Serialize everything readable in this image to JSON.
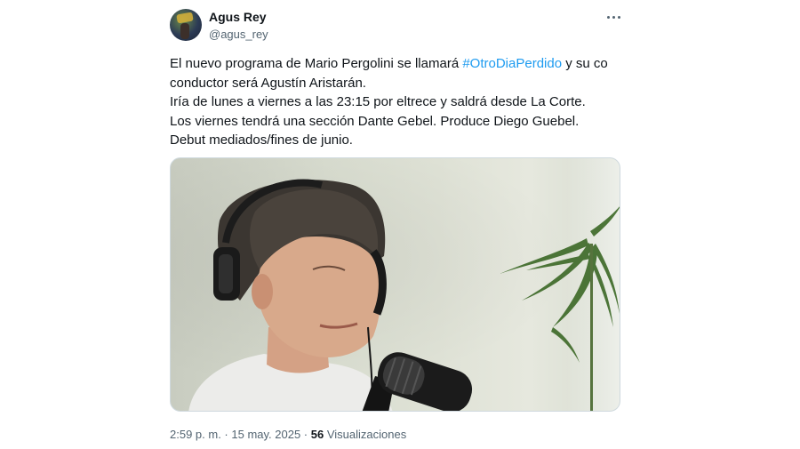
{
  "author": {
    "name": "Agus Rey",
    "handle": "@agus_rey"
  },
  "tweet": {
    "line1_prefix": "El nuevo programa de Mario Pergolini se llamará ",
    "hashtag": "#OtroDiaPerdido",
    "line1_suffix": " y su co",
    "line2": "conductor será Agustín Aristarán.",
    "line3": "Iría de lunes a viernes a las 23:15 por eltrece y saldrá desde La Corte.",
    "line4": "Los viernes tendrá una sección Dante Gebel. Produce Diego Guebel.",
    "line5": "Debut mediados/fines de junio."
  },
  "footer": {
    "time": "2:59 p. m.",
    "separator1": " · ",
    "date": "15 may. 2025",
    "separator2": " · ",
    "views_count": "56",
    "views_label": " Visualizaciones"
  },
  "icons": {
    "more": "more-options-icon"
  },
  "colors": {
    "link": "#1d9bf0",
    "text": "#0f1419",
    "secondary": "#536471"
  }
}
